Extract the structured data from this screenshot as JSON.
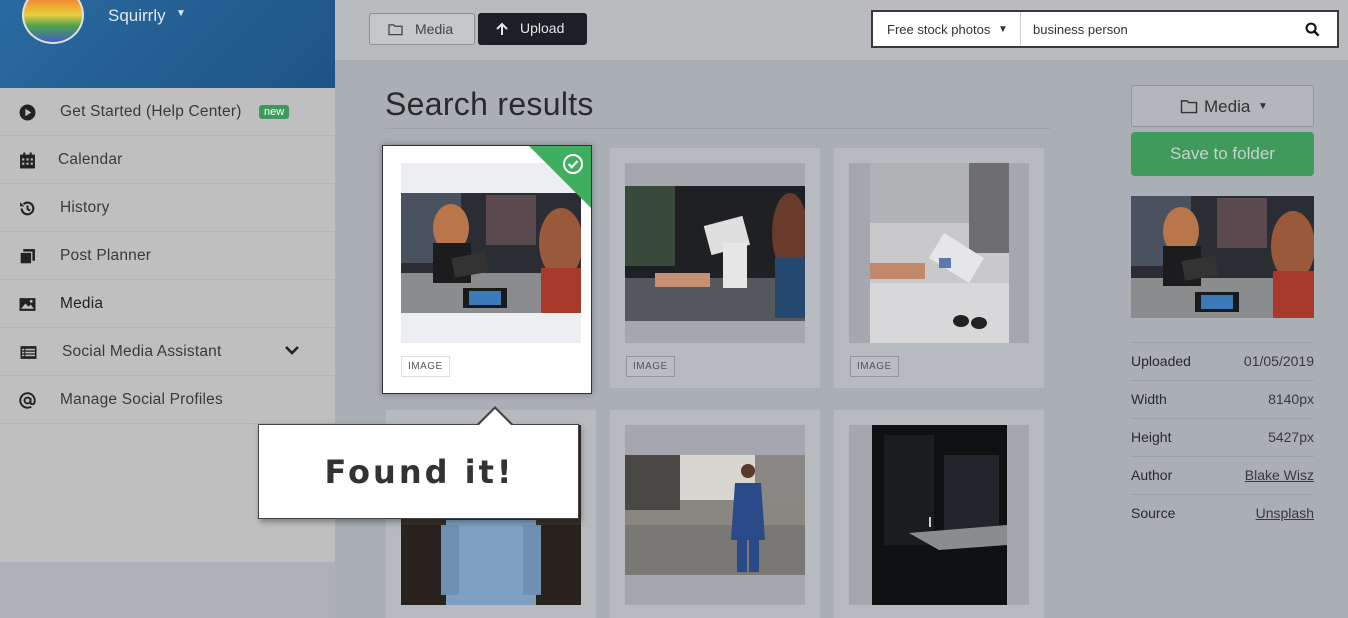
{
  "brand": {
    "name": "Squirrly"
  },
  "sidebar": {
    "items": [
      {
        "label": "Get Started (Help Center)",
        "badge": "new",
        "icon": "play-circle-icon"
      },
      {
        "label": "Calendar",
        "icon": "calendar-icon"
      },
      {
        "label": "History",
        "icon": "history-icon"
      },
      {
        "label": "Post Planner",
        "icon": "stack-icon"
      },
      {
        "label": "Media",
        "icon": "image-icon",
        "active": true
      },
      {
        "label": "Social Media Assistant",
        "icon": "list-icon",
        "expandable": true
      },
      {
        "label": "Manage Social Profiles",
        "icon": "at-icon"
      }
    ]
  },
  "toolbar": {
    "media_label": "Media",
    "upload_label": "Upload"
  },
  "search": {
    "source": "Free stock photos",
    "query": "business person"
  },
  "main": {
    "title": "Search results",
    "results": [
      {
        "tag": "IMAGE",
        "selected": true
      },
      {
        "tag": "IMAGE",
        "selected": false
      },
      {
        "tag": "IMAGE",
        "selected": false
      },
      {
        "tag": "",
        "selected": false
      },
      {
        "tag": "",
        "selected": false
      },
      {
        "tag": "",
        "selected": false
      }
    ]
  },
  "callout": {
    "text": "Found it!"
  },
  "panel": {
    "folder_label": "Media",
    "save_label": "Save to folder",
    "details": [
      {
        "key": "Uploaded",
        "value": "01/05/2019"
      },
      {
        "key": "Width",
        "value": "8140px"
      },
      {
        "key": "Height",
        "value": "5427px"
      },
      {
        "key": "Author",
        "value": "Blake Wisz"
      },
      {
        "key": "Source",
        "value": "Unsplash"
      }
    ]
  },
  "colors": {
    "accent_green": "#3fae5e",
    "brand_blue": "#2a6aa0",
    "dark_button": "#1c2026"
  }
}
